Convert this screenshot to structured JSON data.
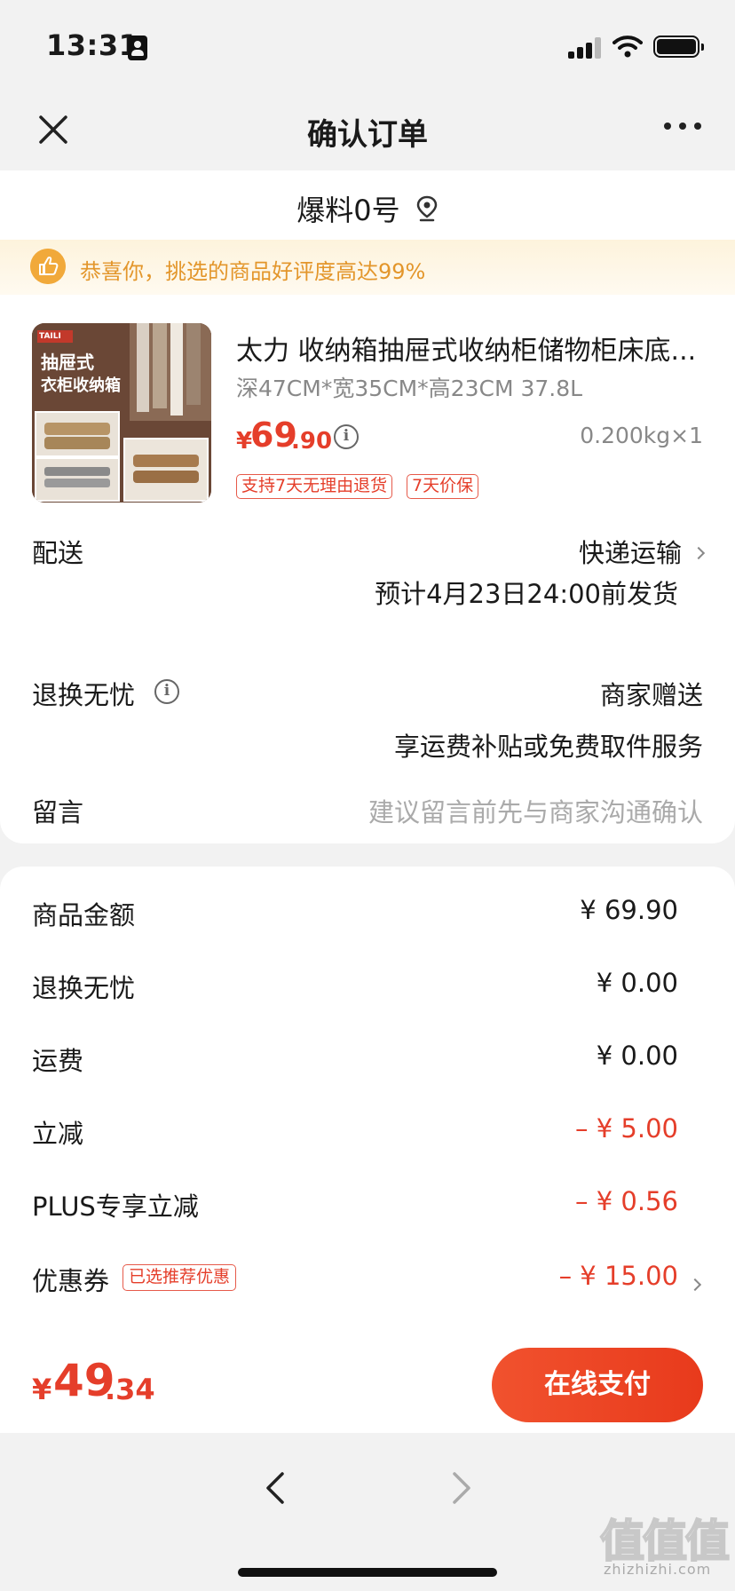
{
  "status_bar": {
    "time": "13:31"
  },
  "nav": {
    "title": "确认订单"
  },
  "shop": {
    "name": "爆料0号"
  },
  "banner": {
    "text": "恭喜你，挑选的商品好评度高达99%"
  },
  "product": {
    "title": "太力 收纳箱抽屉式收纳柜储物柜床底...",
    "spec": "深47CM*宽35CM*高23CM 37.8L",
    "price_symbol": "¥",
    "price_int": "69",
    "price_dec": ".90",
    "weight_qty": "0.200kg×1",
    "tags": [
      "支持7天无理由退货",
      "7天价保"
    ],
    "image_text": {
      "line1": "抽屉式",
      "line2": "衣柜收纳箱",
      "brand": "TAILI"
    }
  },
  "delivery": {
    "label": "配送",
    "method": "快递运输",
    "estimate": "预计4月23日24:00前发货"
  },
  "return_service": {
    "label": "退换无忧",
    "value": "商家赠送",
    "desc": "享运费补贴或免费取件服务"
  },
  "message": {
    "label": "留言",
    "placeholder": "建议留言前先与商家沟通确认"
  },
  "summary": {
    "rows": [
      {
        "label": "商品金额",
        "value": "¥ 69.90"
      },
      {
        "label": "退换无忧",
        "value": "¥ 0.00"
      },
      {
        "label": "运费",
        "value": "¥ 0.00"
      },
      {
        "label": "立减",
        "value": "– ¥ 5.00"
      },
      {
        "label": "PLUS专享立减",
        "value": "– ¥ 0.56"
      },
      {
        "label": "优惠券",
        "value": "– ¥ 15.00"
      }
    ],
    "coupon_tag": "已选推荐优惠"
  },
  "footer": {
    "total_symbol": "¥",
    "total_int": "49",
    "total_dec": ".34",
    "pay_label": "在线支付"
  },
  "watermark": {
    "chars": "值值值",
    "sub": "zhizhizhi.com"
  },
  "colors": {
    "accent": "#e53e2a",
    "banner_text": "#e3962b",
    "banner_bg": "#fdf3dc"
  },
  "icons": [
    "close-icon",
    "more-icon",
    "location-icon",
    "thumbs-up-icon",
    "info-icon",
    "chevron-right-icon",
    "back-arrow-icon",
    "forward-arrow-icon"
  ]
}
